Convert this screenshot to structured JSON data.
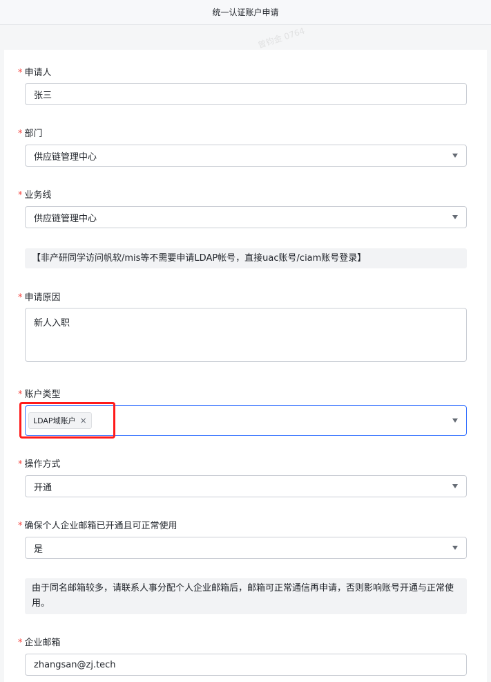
{
  "window": {
    "title": "统一认证账户申请"
  },
  "form": {
    "applicant": {
      "label": "申请人",
      "value": "张三"
    },
    "department": {
      "label": "部门",
      "value": "供应链管理中心"
    },
    "business_line": {
      "label": "业务线",
      "value": "供应链管理中心"
    },
    "notice_ldap": "【非产研同学访问帆软/mis等不需要申请LDAP帐号，直接uac账号/ciam账号登录】",
    "reason": {
      "label": "申请原因",
      "value": "新人入职"
    },
    "account_type": {
      "label": "账户类型",
      "tag": "LDAP域账户",
      "remove_icon": "close-icon"
    },
    "operation": {
      "label": "操作方式",
      "value": "开通"
    },
    "email_confirm": {
      "label": "确保个人企业邮箱已开通且可正常使用",
      "value": "是"
    },
    "notice_email": "由于同名邮箱较多，请联系人事分配个人企业邮箱后，邮箱可正常通信再申请，否则影响账号开通与正常使用。",
    "email": {
      "label": "企业邮箱",
      "value": "zhangsan@zj.tech"
    }
  },
  "required_mark": "*",
  "watermark": "曾钧金 0764",
  "colors": {
    "required": "#f54a45",
    "focus": "#3370ff",
    "highlight": "#ff1a1a"
  }
}
